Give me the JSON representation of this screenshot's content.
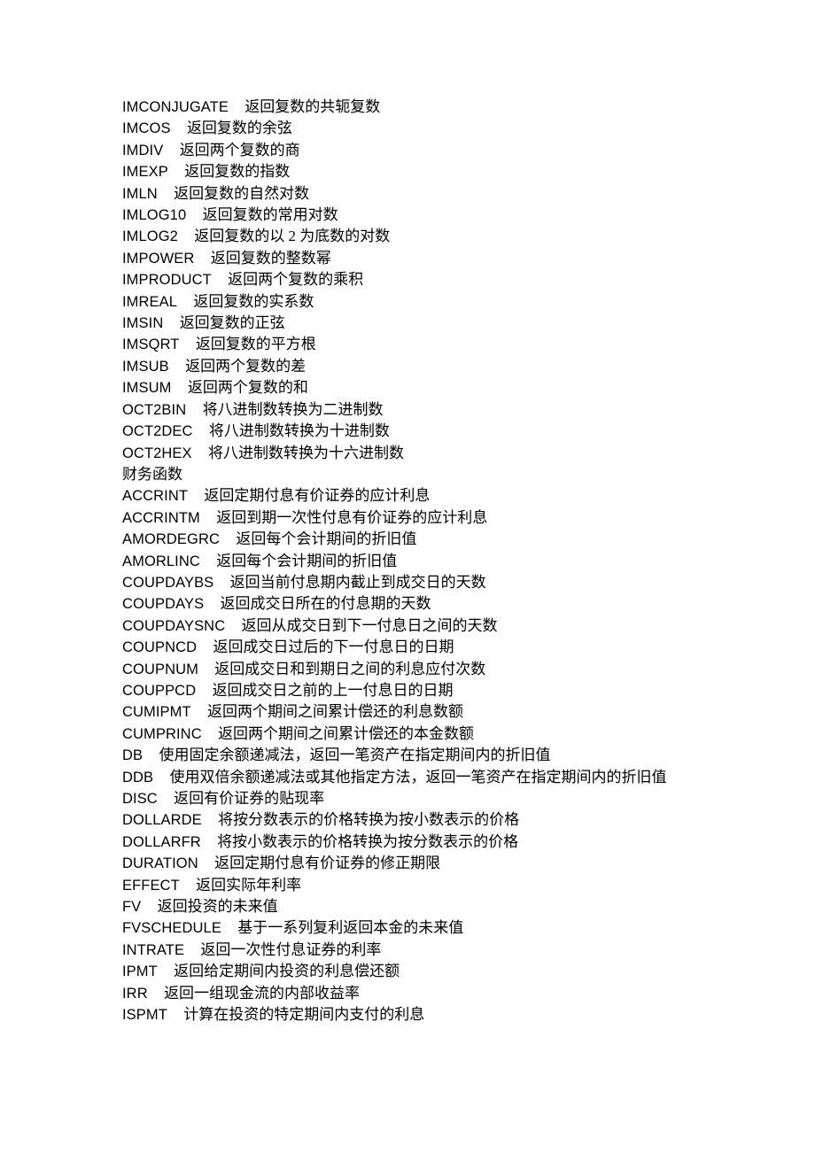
{
  "document": {
    "page_background": "#ffffff",
    "text_color": "#000000",
    "body": [
      {
        "kind": "entry",
        "name": "IMCONJUGATE",
        "gap": "    ",
        "desc": "返回复数的共轭复数"
      },
      {
        "kind": "entry",
        "name": "IMCOS",
        "gap": "    ",
        "desc": "返回复数的余弦"
      },
      {
        "kind": "entry",
        "name": "IMDIV",
        "gap": "    ",
        "desc": "返回两个复数的商"
      },
      {
        "kind": "entry",
        "name": "IMEXP",
        "gap": "    ",
        "desc": "返回复数的指数"
      },
      {
        "kind": "entry",
        "name": "IMLN",
        "gap": "    ",
        "desc": "返回复数的自然对数"
      },
      {
        "kind": "entry",
        "name": "IMLOG10",
        "gap": "    ",
        "desc": "返回复数的常用对数"
      },
      {
        "kind": "entry",
        "name": "IMLOG2",
        "gap": "    ",
        "desc": "返回复数的以 2 为底数的对数"
      },
      {
        "kind": "entry",
        "name": "IMPOWER",
        "gap": "    ",
        "desc": "返回复数的整数幂"
      },
      {
        "kind": "entry",
        "name": "IMPRODUCT",
        "gap": "    ",
        "desc": "返回两个复数的乘积"
      },
      {
        "kind": "entry",
        "name": "IMREAL",
        "gap": "    ",
        "desc": "返回复数的实系数"
      },
      {
        "kind": "entry",
        "name": "IMSIN",
        "gap": "    ",
        "desc": "返回复数的正弦"
      },
      {
        "kind": "entry",
        "name": "IMSQRT",
        "gap": "    ",
        "desc": "返回复数的平方根"
      },
      {
        "kind": "entry",
        "name": "IMSUB",
        "gap": "    ",
        "desc": "返回两个复数的差"
      },
      {
        "kind": "entry",
        "name": "IMSUM",
        "gap": "    ",
        "desc": "返回两个复数的和"
      },
      {
        "kind": "entry",
        "name": "OCT2BIN",
        "gap": "    ",
        "desc": "将八进制数转换为二进制数"
      },
      {
        "kind": "entry",
        "name": "OCT2DEC",
        "gap": "    ",
        "desc": "将八进制数转换为十进制数"
      },
      {
        "kind": "entry",
        "name": "OCT2HEX",
        "gap": "    ",
        "desc": "将八进制数转换为十六进制数"
      },
      {
        "kind": "heading",
        "text": "财务函数"
      },
      {
        "kind": "entry",
        "name": "ACCRINT",
        "gap": "    ",
        "desc": "返回定期付息有价证券的应计利息"
      },
      {
        "kind": "entry",
        "name": "ACCRINTM",
        "gap": "    ",
        "desc": "返回到期一次性付息有价证券的应计利息"
      },
      {
        "kind": "entry",
        "name": "AMORDEGRC",
        "gap": "    ",
        "desc": "返回每个会计期间的折旧值"
      },
      {
        "kind": "entry",
        "name": "AMORLINC",
        "gap": "    ",
        "desc": "返回每个会计期间的折旧值"
      },
      {
        "kind": "entry",
        "name": "COUPDAYBS",
        "gap": "    ",
        "desc": "返回当前付息期内截止到成交日的天数"
      },
      {
        "kind": "entry",
        "name": "COUPDAYS",
        "gap": "    ",
        "desc": "返回成交日所在的付息期的天数"
      },
      {
        "kind": "entry",
        "name": "COUPDAYSNC",
        "gap": "    ",
        "desc": "返回从成交日到下一付息日之间的天数"
      },
      {
        "kind": "entry",
        "name": "COUPNCD",
        "gap": "    ",
        "desc": "返回成交日过后的下一付息日的日期"
      },
      {
        "kind": "entry",
        "name": "COUPNUM",
        "gap": "    ",
        "desc": "返回成交日和到期日之间的利息应付次数"
      },
      {
        "kind": "entry",
        "name": "COUPPCD",
        "gap": "    ",
        "desc": "返回成交日之前的上一付息日的日期"
      },
      {
        "kind": "entry",
        "name": "CUMIPMT",
        "gap": "    ",
        "desc": "返回两个期间之间累计偿还的利息数额"
      },
      {
        "kind": "entry",
        "name": "CUMPRINC",
        "gap": "    ",
        "desc": "返回两个期间之间累计偿还的本金数额"
      },
      {
        "kind": "entry",
        "name": "DB",
        "gap": "    ",
        "desc": "使用固定余额递减法，返回一笔资产在指定期间内的折旧值"
      },
      {
        "kind": "entry",
        "name": "DDB",
        "gap": "    ",
        "desc": "使用双倍余额递减法或其他指定方法，返回一笔资产在指定期间内的折旧值"
      },
      {
        "kind": "entry",
        "name": "DISC",
        "gap": "    ",
        "desc": "返回有价证券的贴现率"
      },
      {
        "kind": "entry",
        "name": "DOLLARDE",
        "gap": "    ",
        "desc": "将按分数表示的价格转换为按小数表示的价格"
      },
      {
        "kind": "entry",
        "name": "DOLLARFR",
        "gap": "    ",
        "desc": "将按小数表示的价格转换为按分数表示的价格"
      },
      {
        "kind": "entry",
        "name": "DURATION",
        "gap": "    ",
        "desc": "返回定期付息有价证券的修正期限"
      },
      {
        "kind": "entry",
        "name": "EFFECT",
        "gap": "    ",
        "desc": "返回实际年利率"
      },
      {
        "kind": "entry",
        "name": "FV",
        "gap": "    ",
        "desc": "返回投资的未来值"
      },
      {
        "kind": "entry",
        "name": "FVSCHEDULE",
        "gap": "    ",
        "desc": "基于一系列复利返回本金的未来值"
      },
      {
        "kind": "entry",
        "name": "INTRATE",
        "gap": "    ",
        "desc": "返回一次性付息证券的利率"
      },
      {
        "kind": "entry",
        "name": "IPMT",
        "gap": "    ",
        "desc": "返回给定期间内投资的利息偿还额"
      },
      {
        "kind": "entry",
        "name": "IRR",
        "gap": "    ",
        "desc": "返回一组现金流的内部收益率"
      },
      {
        "kind": "entry",
        "name": "ISPMT",
        "gap": "    ",
        "desc": "计算在投资的特定期间内支付的利息"
      }
    ]
  }
}
